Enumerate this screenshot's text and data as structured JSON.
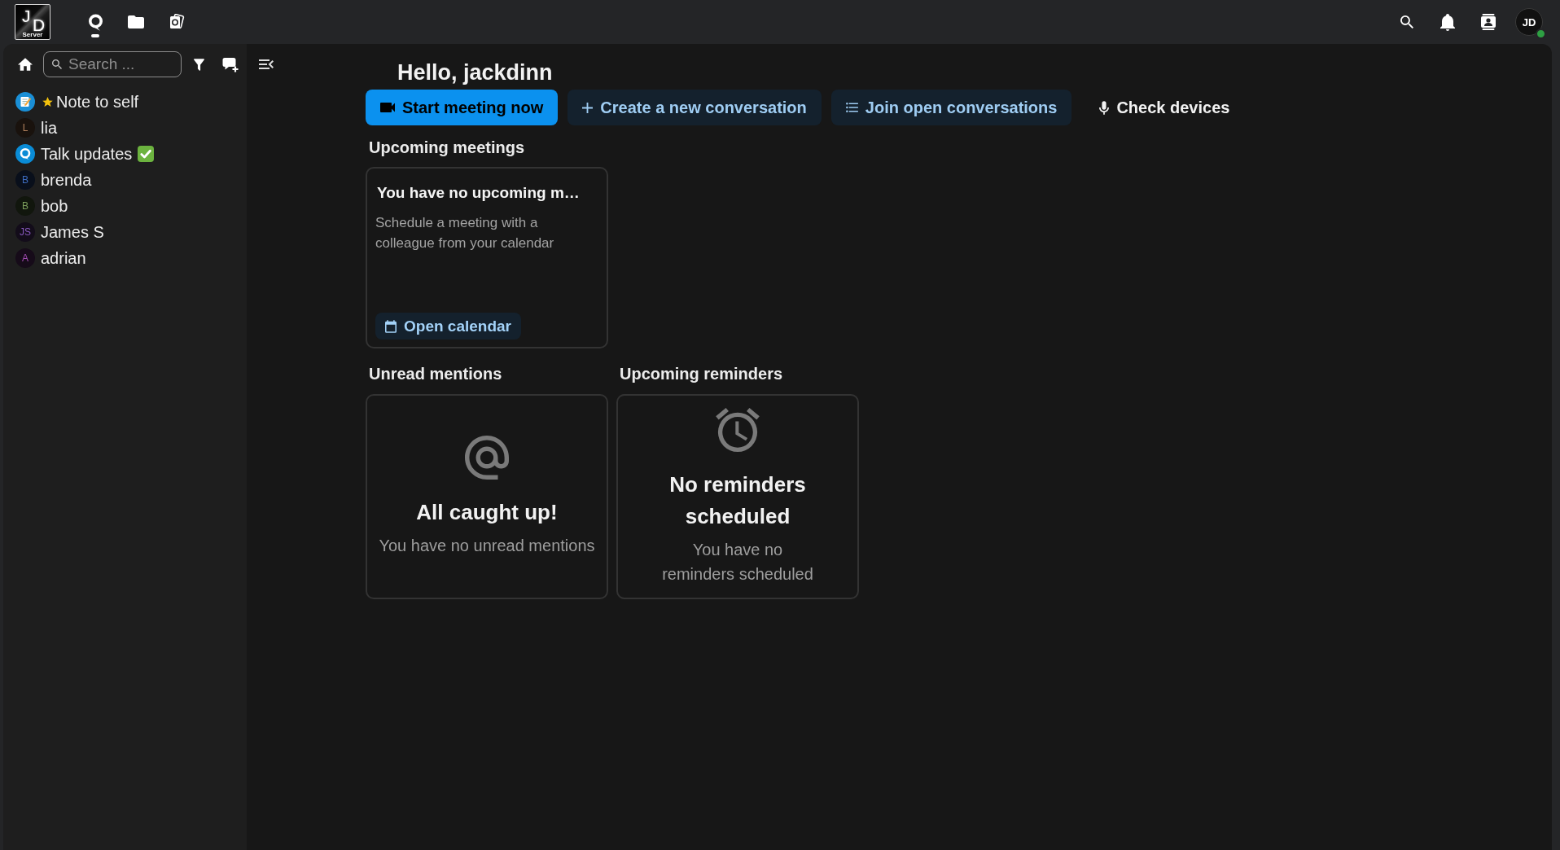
{
  "top_bar": {
    "logo": {
      "letters": [
        "J",
        "D"
      ],
      "caption": "Server"
    },
    "apps": [
      {
        "kind": "talk",
        "selected": true
      },
      {
        "kind": "files",
        "selected": false
      },
      {
        "kind": "photos",
        "selected": false
      }
    ],
    "user": {
      "initials": "JD",
      "online": true
    }
  },
  "sidebar": {
    "search": {
      "placeholder": "Search ..."
    },
    "conversations": [
      {
        "name": "Note to self",
        "kind": "note",
        "color": "#1a8fd6",
        "favorite": true,
        "check_mark": false
      },
      {
        "name": "lia",
        "kind": "user",
        "initials": "L",
        "color": "#b0805c",
        "favorite": false,
        "check_mark": false
      },
      {
        "name": "Talk updates",
        "kind": "talk",
        "color": "#0a8cd6",
        "favorite": false,
        "check_mark": true
      },
      {
        "name": "brenda",
        "kind": "user",
        "initials": "B",
        "color": "#3d6cc0",
        "favorite": false,
        "check_mark": false
      },
      {
        "name": "bob",
        "kind": "user",
        "initials": "B",
        "color": "#7c9e5c",
        "favorite": false,
        "check_mark": false
      },
      {
        "name": "James S",
        "kind": "user",
        "initials": "JS",
        "color": "#8758bd",
        "favorite": false,
        "check_mark": false
      },
      {
        "name": "adrian",
        "kind": "user",
        "initials": "A",
        "color": "#a04bb0",
        "favorite": false,
        "check_mark": false
      }
    ]
  },
  "main": {
    "greeting": "Hello, jackdinn",
    "actions": [
      {
        "label": "Start meeting now",
        "kind": "meeting"
      },
      {
        "label": "Create a new conversation",
        "kind": "create"
      },
      {
        "label": "Join open conversations",
        "kind": "browse"
      },
      {
        "label": "Check devices",
        "kind": "devices"
      }
    ],
    "upcoming_meetings": {
      "title": "Upcoming meetings",
      "card": {
        "title": "You have no upcoming m…",
        "description": "Schedule a meeting with a colleague from your calendar",
        "button": "Open calendar"
      }
    },
    "unread_mentions": {
      "title": "Unread mentions",
      "empty": {
        "title": "All caught up!",
        "description": "You have no unread mentions"
      }
    },
    "upcoming_reminders": {
      "title": "Upcoming reminders",
      "empty": {
        "title": "No reminders scheduled",
        "description": "You have no reminders scheduled"
      }
    }
  }
}
